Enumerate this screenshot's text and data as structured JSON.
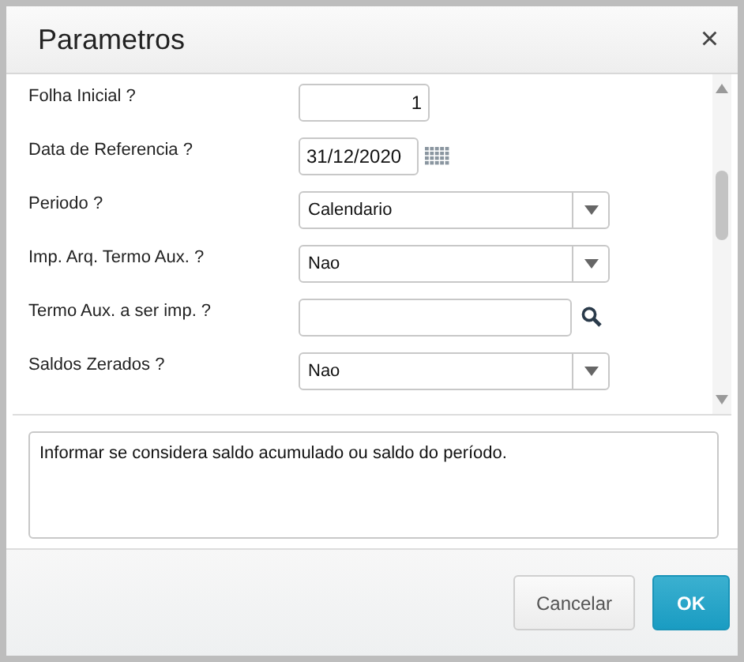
{
  "window": {
    "title": "Parametros",
    "close": "×"
  },
  "fields": [
    {
      "kind": "number",
      "label": "Folha Inicial ?",
      "value": "1"
    },
    {
      "kind": "date",
      "label": "Data de Referencia ?",
      "value": "31/12/2020"
    },
    {
      "kind": "select",
      "label": "Periodo ?",
      "value": "Calendario"
    },
    {
      "kind": "select",
      "label": "Imp. Arq. Termo Aux. ?",
      "value": "Nao"
    },
    {
      "kind": "lookup",
      "label": "Termo Aux. a ser imp. ?"
    },
    {
      "kind": "select",
      "label": "Saldos Zerados ?",
      "value": "Nao"
    }
  ],
  "help_text": "Informar se considera saldo acumulado ou saldo do período.",
  "buttons": [
    {
      "kind": "secondary",
      "label": "Cancelar"
    },
    {
      "kind": "primary",
      "label": "OK"
    }
  ]
}
